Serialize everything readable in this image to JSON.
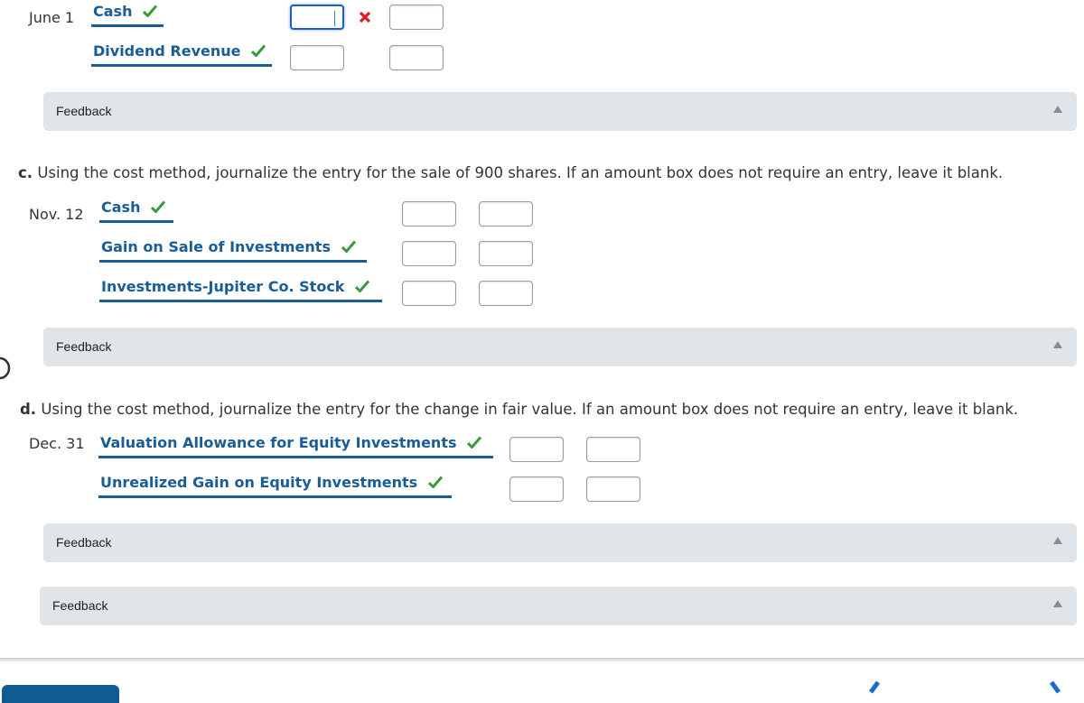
{
  "part_b": {
    "date": "June 1",
    "rows": [
      {
        "account": "Cash",
        "status": "correct",
        "debit_value": "",
        "credit_value": "",
        "debit_status": "incorrect"
      },
      {
        "account": "Dividend Revenue",
        "status": "correct",
        "debit_value": "",
        "credit_value": ""
      }
    ],
    "feedback_label": "Feedback"
  },
  "part_c": {
    "letter": "c.",
    "instruction": "Using the cost method, journalize the entry for the sale of 900 shares. If an amount box does not require an entry, leave it blank.",
    "date": "Nov. 12",
    "rows": [
      {
        "account": "Cash",
        "status": "correct",
        "debit_value": "",
        "credit_value": ""
      },
      {
        "account": "Gain on Sale of Investments",
        "status": "correct",
        "debit_value": "",
        "credit_value": ""
      },
      {
        "account": "Investments-Jupiter Co. Stock",
        "status": "correct",
        "debit_value": "",
        "credit_value": ""
      }
    ],
    "feedback_label": "Feedback"
  },
  "part_d": {
    "letter": "d.",
    "instruction": "Using the cost method, journalize the entry for the change in fair value. If an amount box does not require an entry, leave it blank.",
    "date": "Dec. 31",
    "rows": [
      {
        "account": "Valuation Allowance for Equity Investments",
        "status": "correct",
        "debit_value": "",
        "credit_value": ""
      },
      {
        "account": "Unrealized Gain on Equity Investments",
        "status": "correct",
        "debit_value": "",
        "credit_value": ""
      }
    ],
    "feedback_label": "Feedback"
  },
  "overall_feedback_label": "Feedback",
  "icons": {
    "correct": "checkmark-icon",
    "incorrect": "x-mark-icon",
    "expand": "triangle-up-icon",
    "prev": "chevron-left-icon",
    "next": "chevron-right-icon"
  },
  "colors": {
    "account_blue": "#1a5d96",
    "check_green": "#3a9a3a",
    "error_red": "#e01b1b",
    "feedback_bg": "#dfe5e9",
    "focus_blue": "#1a5fc8"
  }
}
